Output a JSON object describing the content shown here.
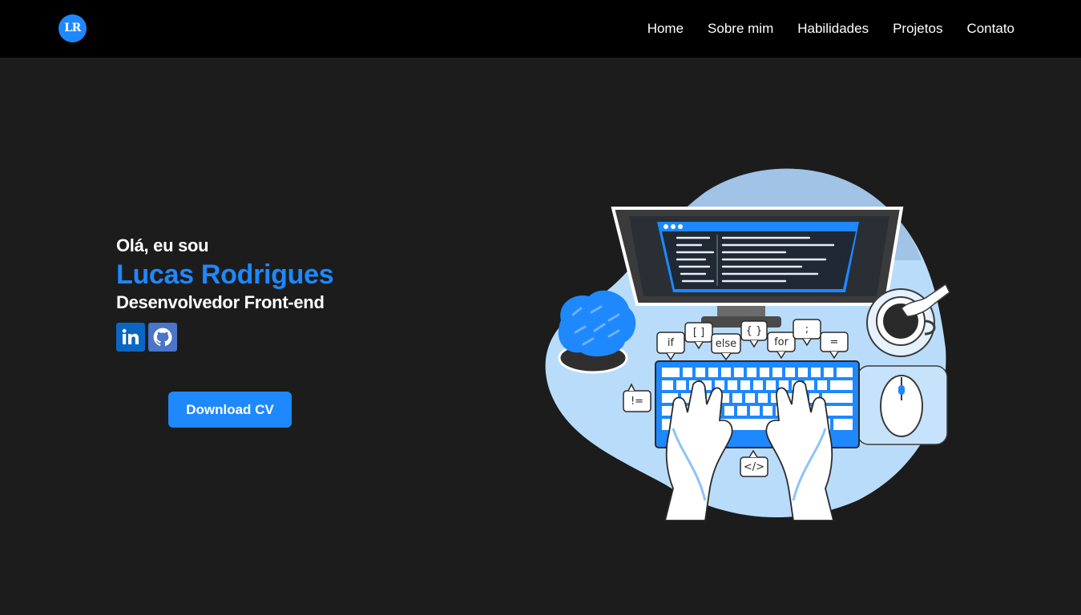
{
  "header": {
    "logo_text": "LR",
    "nav": [
      "Home",
      "Sobre mim",
      "Habilidades",
      "Projetos",
      "Contato"
    ]
  },
  "hero": {
    "greeting": "Olá, eu sou",
    "name": "Lucas Rodrigues",
    "role": "Desenvolvedor Front-end",
    "download_label": "Download CV",
    "social_icons": [
      "linkedin-icon",
      "github-icon"
    ]
  },
  "illustration": {
    "tokens": [
      "if",
      "[ ]",
      "else",
      "{ }",
      "for",
      ";",
      "=",
      "!=",
      "</>"
    ]
  },
  "colors": {
    "accent": "#1e88ff",
    "background": "#1c1c1c",
    "navbar": "#000000"
  }
}
